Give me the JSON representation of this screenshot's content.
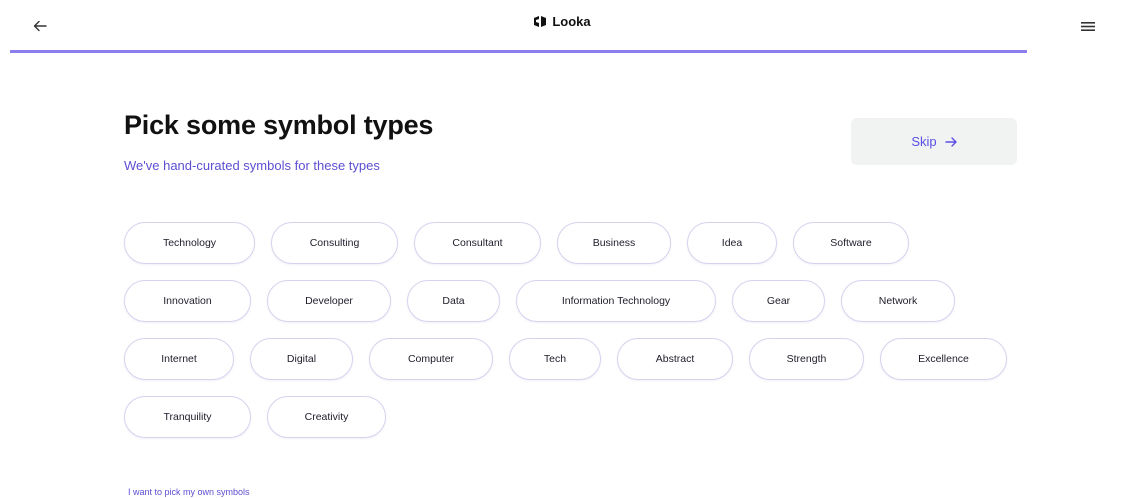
{
  "header": {
    "brand": "Looka",
    "progress_fraction": 0.9
  },
  "page": {
    "title": "Pick some symbol types",
    "subtitle": "We've hand-curated symbols for these types",
    "skip_label": "Skip",
    "own_symbols_link": "I want to pick my own symbols"
  },
  "chips": {
    "row1": [
      "Technology",
      "Consulting",
      "Consultant",
      "Business",
      "Idea",
      "Software"
    ],
    "row2": [
      "Innovation",
      "Developer",
      "Data",
      "Information Technology",
      "Gear",
      "Network"
    ],
    "row3": [
      "Internet",
      "Digital",
      "Computer",
      "Tech",
      "Abstract",
      "Strength",
      "Excellence"
    ],
    "row4": [
      "Tranquility",
      "Creativity"
    ]
  },
  "icons": {
    "back": "arrow-left-icon",
    "menu": "hamburger-menu-icon",
    "skip": "arrow-right-icon",
    "logo": "looka-logo-icon"
  },
  "colors": {
    "accent": "#5b4ee6",
    "progress": "#8b7ff0",
    "chip_border": "#d7d2ee",
    "skip_bg": "#f1f2f2"
  }
}
